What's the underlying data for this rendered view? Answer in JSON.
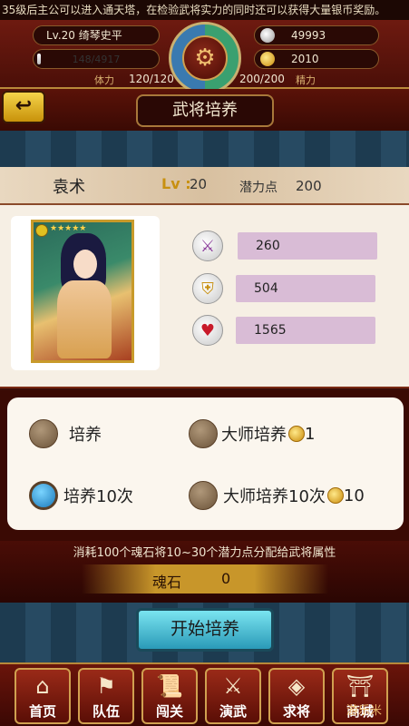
{
  "marquee": {
    "text": "35级后主公可以进入通天塔，在检验武将实力的同时还可以获得大量银币奖励。"
  },
  "header": {
    "level_text": "Lv.20  绮琴史平",
    "exp_text": "148/4917",
    "exp_fraction": 0.03,
    "silver": "49993",
    "gold": "2010",
    "stamina_label": "体力",
    "stamina_value": "120/120",
    "energy_value": "200/200",
    "energy_label": "精力"
  },
  "titlebar": {
    "back_glyph": "↩",
    "title": "武将培养"
  },
  "general": {
    "name": "袁术",
    "lv_label": "Lv :",
    "lv_value": "20",
    "potential_label": "潜力点",
    "potential_value": "200"
  },
  "stats": [
    {
      "icon": "swords-icon",
      "glyph": "⚔",
      "value": "260"
    },
    {
      "icon": "shield-icon",
      "glyph": "⛨",
      "value": "504"
    },
    {
      "icon": "heart-icon",
      "glyph": "♥",
      "value": "1565"
    }
  ],
  "options": {
    "train": "培养",
    "master_train": "大师培养",
    "master_train_cost": "1",
    "train10": "培养10次",
    "master_train10": "大师培养10次",
    "master_train10_cost": "10",
    "selected": "train10"
  },
  "info": {
    "description": "消耗100个魂石将10~30个潜力点分配给武将属性",
    "soul_label": "魂石",
    "soul_value": "0"
  },
  "start_button": "开始培养",
  "nav": [
    {
      "label": "首页",
      "icon": "home-icon",
      "glyph": "⌂"
    },
    {
      "label": "队伍",
      "icon": "flag-icon",
      "glyph": "⚑"
    },
    {
      "label": "闯关",
      "icon": "scroll-icon",
      "glyph": "📜"
    },
    {
      "label": "演武",
      "icon": "crossed-swords-icon",
      "glyph": "⚔"
    },
    {
      "label": "求将",
      "icon": "token-icon",
      "glyph": "◈"
    },
    {
      "label": "商城",
      "icon": "shop-icon",
      "glyph": "⛩"
    }
  ],
  "watermark": "游乐米"
}
